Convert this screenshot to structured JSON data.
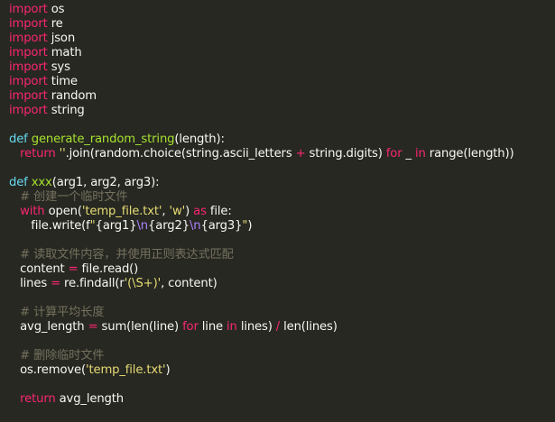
{
  "editor": {
    "lines": [
      [
        {
          "t": "import",
          "c": "kw"
        },
        {
          "t": " os",
          "c": ""
        }
      ],
      [
        {
          "t": "import",
          "c": "kw"
        },
        {
          "t": " re",
          "c": ""
        }
      ],
      [
        {
          "t": "import",
          "c": "kw"
        },
        {
          "t": " json",
          "c": ""
        }
      ],
      [
        {
          "t": "import",
          "c": "kw"
        },
        {
          "t": " math",
          "c": ""
        }
      ],
      [
        {
          "t": "import",
          "c": "kw"
        },
        {
          "t": " sys",
          "c": ""
        }
      ],
      [
        {
          "t": "import",
          "c": "kw"
        },
        {
          "t": " time",
          "c": ""
        }
      ],
      [
        {
          "t": "import",
          "c": "kw"
        },
        {
          "t": " random",
          "c": ""
        }
      ],
      [
        {
          "t": "import",
          "c": "kw"
        },
        {
          "t": " string",
          "c": ""
        }
      ],
      [],
      [
        {
          "t": "def",
          "c": "bl"
        },
        {
          "t": " ",
          "c": ""
        },
        {
          "t": "generate_random_string",
          "c": "fn"
        },
        {
          "t": "(length):",
          "c": ""
        }
      ],
      [
        {
          "t": "   ",
          "c": ""
        },
        {
          "t": "return",
          "c": "kw"
        },
        {
          "t": " ",
          "c": ""
        },
        {
          "t": "''",
          "c": "str"
        },
        {
          "t": ".join(random.choice(string.ascii_letters ",
          "c": ""
        },
        {
          "t": "+",
          "c": "op"
        },
        {
          "t": " string.digits) ",
          "c": ""
        },
        {
          "t": "for",
          "c": "kw"
        },
        {
          "t": " _ ",
          "c": ""
        },
        {
          "t": "in",
          "c": "kw"
        },
        {
          "t": " range(length))",
          "c": ""
        }
      ],
      [],
      [
        {
          "t": "def",
          "c": "bl"
        },
        {
          "t": " ",
          "c": ""
        },
        {
          "t": "xxx",
          "c": "fn"
        },
        {
          "t": "(arg1, arg2, arg3):",
          "c": ""
        }
      ],
      [
        {
          "t": "   # 创建一个临时文件",
          "c": "com"
        }
      ],
      [
        {
          "t": "   ",
          "c": ""
        },
        {
          "t": "with",
          "c": "kw"
        },
        {
          "t": " open(",
          "c": ""
        },
        {
          "t": "'temp_file.txt'",
          "c": "str"
        },
        {
          "t": ", ",
          "c": ""
        },
        {
          "t": "'w'",
          "c": "str"
        },
        {
          "t": ") ",
          "c": ""
        },
        {
          "t": "as",
          "c": "kw"
        },
        {
          "t": " file:",
          "c": ""
        }
      ],
      [
        {
          "t": "      file.write(f",
          "c": ""
        },
        {
          "t": "\"",
          "c": "str"
        },
        {
          "t": "{arg1}",
          "c": ""
        },
        {
          "t": "\\n",
          "c": "esc"
        },
        {
          "t": "{arg2}",
          "c": ""
        },
        {
          "t": "\\n",
          "c": "esc"
        },
        {
          "t": "{arg3}",
          "c": ""
        },
        {
          "t": "\"",
          "c": "str"
        },
        {
          "t": ")",
          "c": ""
        }
      ],
      [],
      [
        {
          "t": "   # 读取文件内容，并使用正则表达式匹配",
          "c": "com"
        }
      ],
      [
        {
          "t": "   content ",
          "c": ""
        },
        {
          "t": "=",
          "c": "op"
        },
        {
          "t": " file.read()",
          "c": ""
        }
      ],
      [
        {
          "t": "   lines ",
          "c": ""
        },
        {
          "t": "=",
          "c": "op"
        },
        {
          "t": " re.findall(r",
          "c": ""
        },
        {
          "t": "'(\\S+)'",
          "c": "str"
        },
        {
          "t": ", content)",
          "c": ""
        }
      ],
      [],
      [
        {
          "t": "   # 计算平均长度",
          "c": "com"
        }
      ],
      [
        {
          "t": "   avg_length ",
          "c": ""
        },
        {
          "t": "=",
          "c": "op"
        },
        {
          "t": " sum(len(line) ",
          "c": ""
        },
        {
          "t": "for",
          "c": "kw"
        },
        {
          "t": " line ",
          "c": ""
        },
        {
          "t": "in",
          "c": "kw"
        },
        {
          "t": " lines) ",
          "c": ""
        },
        {
          "t": "/",
          "c": "op"
        },
        {
          "t": " len(lines)",
          "c": ""
        }
      ],
      [],
      [
        {
          "t": "   # 删除临时文件",
          "c": "com"
        }
      ],
      [
        {
          "t": "   os.remove(",
          "c": ""
        },
        {
          "t": "'temp_file.txt'",
          "c": "str"
        },
        {
          "t": ")",
          "c": ""
        }
      ],
      [],
      [
        {
          "t": "   ",
          "c": ""
        },
        {
          "t": "return",
          "c": "kw"
        },
        {
          "t": " avg_length",
          "c": ""
        }
      ]
    ]
  }
}
